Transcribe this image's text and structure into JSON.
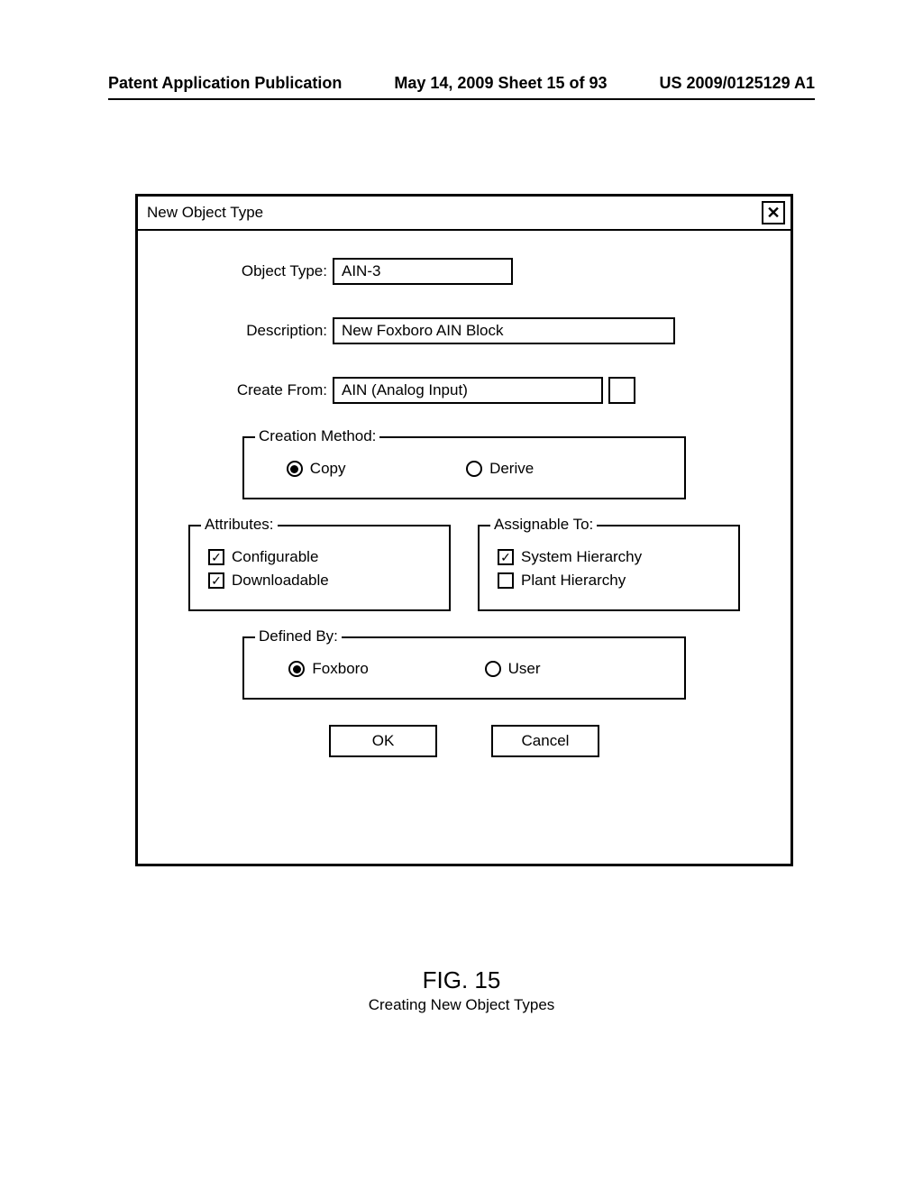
{
  "header": {
    "left": "Patent Application Publication",
    "mid": "May 14, 2009  Sheet 15 of 93",
    "right": "US 2009/0125129 A1"
  },
  "dialog": {
    "title": "New Object Type",
    "fields": {
      "object_type_label": "Object Type:",
      "object_type_value": "AIN-3",
      "description_label": "Description:",
      "description_value": "New Foxboro AIN Block",
      "create_from_label": "Create From:",
      "create_from_value": "AIN (Analog Input)"
    },
    "creation_method": {
      "legend": "Creation Method:",
      "options": [
        "Copy",
        "Derive"
      ],
      "selected": "Copy"
    },
    "attributes": {
      "legend": "Attributes:",
      "items": [
        {
          "label": "Configurable",
          "checked": true
        },
        {
          "label": "Downloadable",
          "checked": true
        }
      ]
    },
    "assignable_to": {
      "legend": "Assignable To:",
      "items": [
        {
          "label": "System Hierarchy",
          "checked": true
        },
        {
          "label": "Plant Hierarchy",
          "checked": false
        }
      ]
    },
    "defined_by": {
      "legend": "Defined By:",
      "options": [
        "Foxboro",
        "User"
      ],
      "selected": "Foxboro"
    },
    "buttons": {
      "ok": "OK",
      "cancel": "Cancel"
    }
  },
  "caption": {
    "fig": "FIG. 15",
    "text": "Creating New Object Types"
  }
}
